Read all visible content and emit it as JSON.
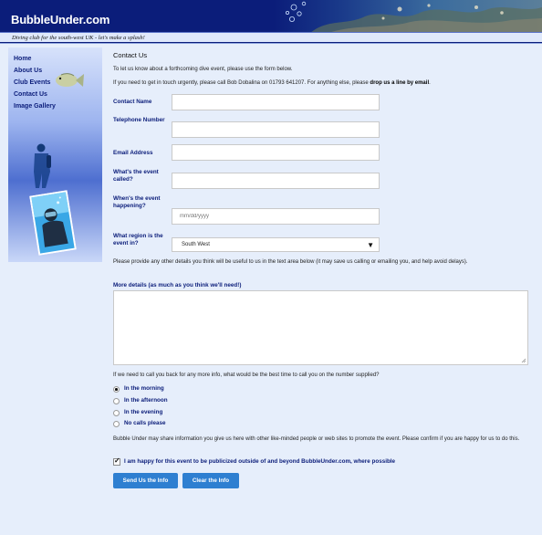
{
  "header": {
    "logo": "BubbleUnder.com",
    "tagline": "Diving club for the south-west UK - let's make a splash!"
  },
  "nav": [
    "Home",
    "About Us",
    "Club Events",
    "Contact Us",
    "Image Gallery"
  ],
  "main": {
    "heading": "Contact Us",
    "intro": "To let us know about a forthcoming dive event, please use the form below.",
    "urgent_text": "If you need to get in touch urgently, please call Bob Dobalina on 01793 641207. For anything else, please ",
    "urgent_link": "drop us a line by email",
    "urgent_end": "."
  },
  "form": {
    "contact_name_label": "Contact Name",
    "telephone_label": "Telephone Number",
    "email_label": "Email Address",
    "event_name_label": "What's the event called?",
    "event_date_label": "When's the event happening?",
    "event_date_placeholder": "mm/dd/yyyy",
    "region_label": "What region is the event in?",
    "region_value": "South West",
    "details_hint": "Please provide any other details you think will be useful to us in the text area below (it may save us calling or emailing you, and help avoid delays).",
    "details_label": "More details (as much as you think we'll need!)",
    "callback_question": "If we need to call you back for any more info, what would be the best time to call you on the number supplied?",
    "callback_options": [
      {
        "label": "In the morning",
        "checked": true
      },
      {
        "label": "In the afternoon",
        "checked": false
      },
      {
        "label": "In the evening",
        "checked": false
      },
      {
        "label": "No calls please",
        "checked": false
      }
    ],
    "share_notice": "Bubble Under may share information you give us here with other like-minded people or web sites to promote the event. Please confirm if you are happy for us to do this.",
    "publicize_label": "I am happy for this event to be publicized outside of and beyond BubbleUnder.com, where possible",
    "publicize_checked": true,
    "submit_label": "Send Us the Info",
    "clear_label": "Clear the Info"
  },
  "colors": {
    "header_bg": "#0b1d7a",
    "page_bg": "#e6eefb",
    "label_text": "#0b1d7a",
    "button_bg": "#2e7fd1"
  }
}
